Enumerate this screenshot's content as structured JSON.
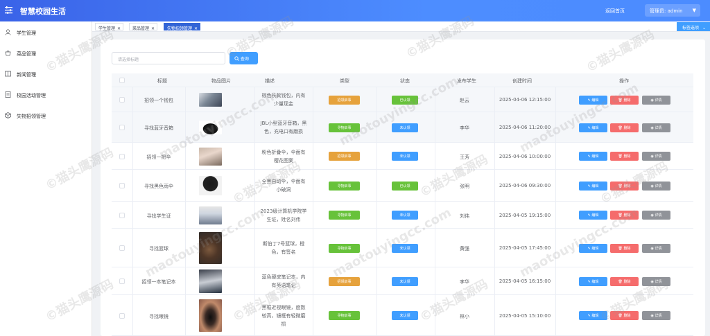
{
  "header": {
    "title": "智慧校园生活",
    "home_link": "返回首页",
    "user_label": "管理员: admin",
    "menu_icon": "menu-toggle-icon",
    "caret_icon": "caret-down-icon"
  },
  "sidebar": {
    "items": [
      {
        "label": "学生管理",
        "icon": "user-icon"
      },
      {
        "label": "菜品管理",
        "icon": "food-icon"
      },
      {
        "label": "新闻管理",
        "icon": "news-icon"
      },
      {
        "label": "校园活动管理",
        "icon": "activity-icon"
      },
      {
        "label": "失物招领管理",
        "icon": "lost-found-icon"
      }
    ]
  },
  "tabs": {
    "items": [
      {
        "label": "学生管理",
        "active": false
      },
      {
        "label": "菜品管理",
        "active": false
      },
      {
        "label": "失物招领管理",
        "active": true
      }
    ],
    "options_label": "标签选项"
  },
  "search": {
    "placeholder": "请选择标题",
    "button_label": "查询"
  },
  "table": {
    "headers": [
      "标题",
      "物品图片",
      "描述",
      "类型",
      "状态",
      "发布学生",
      "创建时间",
      "操作"
    ],
    "actions": {
      "edit": "编辑",
      "delete": "删除",
      "detail": "详情"
    },
    "rows": [
      {
        "title": "招领一个钱包",
        "desc": [
          "棕色长款钱包，内有",
          "少量现金"
        ],
        "type": "招领启事",
        "type_kind": "found",
        "status": "已认领",
        "status_kind": "claimed",
        "student": "赵云",
        "created": "2025-04-06 12:15:00",
        "highlight": true
      },
      {
        "title": "寻找蓝牙音箱",
        "desc": [
          "JBL小型蓝牙音箱，黑",
          "色，充电口有磨损"
        ],
        "type": "寻物启事",
        "type_kind": "lost",
        "status": "未认领",
        "status_kind": "unclaimed",
        "student": "李华",
        "created": "2025-04-06 11:20:00",
        "highlight": true
      },
      {
        "title": "招领一把伞",
        "desc": [
          "粉色折叠伞，伞面有",
          "樱花图案"
        ],
        "type": "招领启事",
        "type_kind": "found",
        "status": "未认领",
        "status_kind": "unclaimed",
        "student": "王芳",
        "created": "2025-04-06 10:00:00",
        "highlight": false
      },
      {
        "title": "寻找黑色雨伞",
        "desc": [
          "全黑自动伞，伞面有",
          "小破洞"
        ],
        "type": "寻物启事",
        "type_kind": "lost",
        "status": "已认领",
        "status_kind": "claimed",
        "student": "张明",
        "created": "2025-04-06 09:30:00",
        "highlight": false
      },
      {
        "title": "寻找学生证",
        "desc": [
          "2023级计算机学院学",
          "生证，姓名刘伟"
        ],
        "type": "寻物启事",
        "type_kind": "lost",
        "status": "未认领",
        "status_kind": "unclaimed",
        "student": "刘伟",
        "created": "2025-04-05 19:15:00",
        "highlight": false
      },
      {
        "title": "寻找篮球",
        "desc": [
          "斯伯丁7号篮球，橙",
          "色，有签名"
        ],
        "type": "寻物启事",
        "type_kind": "lost",
        "status": "未认领",
        "status_kind": "unclaimed",
        "student": "黄强",
        "created": "2025-04-05 17:45:00",
        "highlight": false
      },
      {
        "title": "招领一本笔记本",
        "desc": [
          "蓝色硬皮笔记本，内",
          "有英语笔记"
        ],
        "type": "招领启事",
        "type_kind": "found",
        "status": "未认领",
        "status_kind": "unclaimed",
        "student": "李华",
        "created": "2025-04-05 16:15:00",
        "highlight": false
      },
      {
        "title": "寻找眼镜",
        "desc": [
          "黑框近视眼镜，度数",
          "较高，镜框有轻微磨",
          "损"
        ],
        "type": "寻物启事",
        "type_kind": "lost",
        "status": "未认领",
        "status_kind": "unclaimed",
        "student": "林小",
        "created": "2025-04-05 15:10:00",
        "highlight": false
      }
    ]
  },
  "watermark": {
    "text_cn": "©猫头鹰源码",
    "text_url": "maotouyingcc.com"
  },
  "colors": {
    "header_start": "#3a63e8",
    "header_end": "#4c8cff",
    "primary": "#409eff",
    "success": "#67c23a",
    "warning": "#e6a23c",
    "danger": "#f56c6c",
    "info": "#909399",
    "active_tab": "#3264d6"
  }
}
